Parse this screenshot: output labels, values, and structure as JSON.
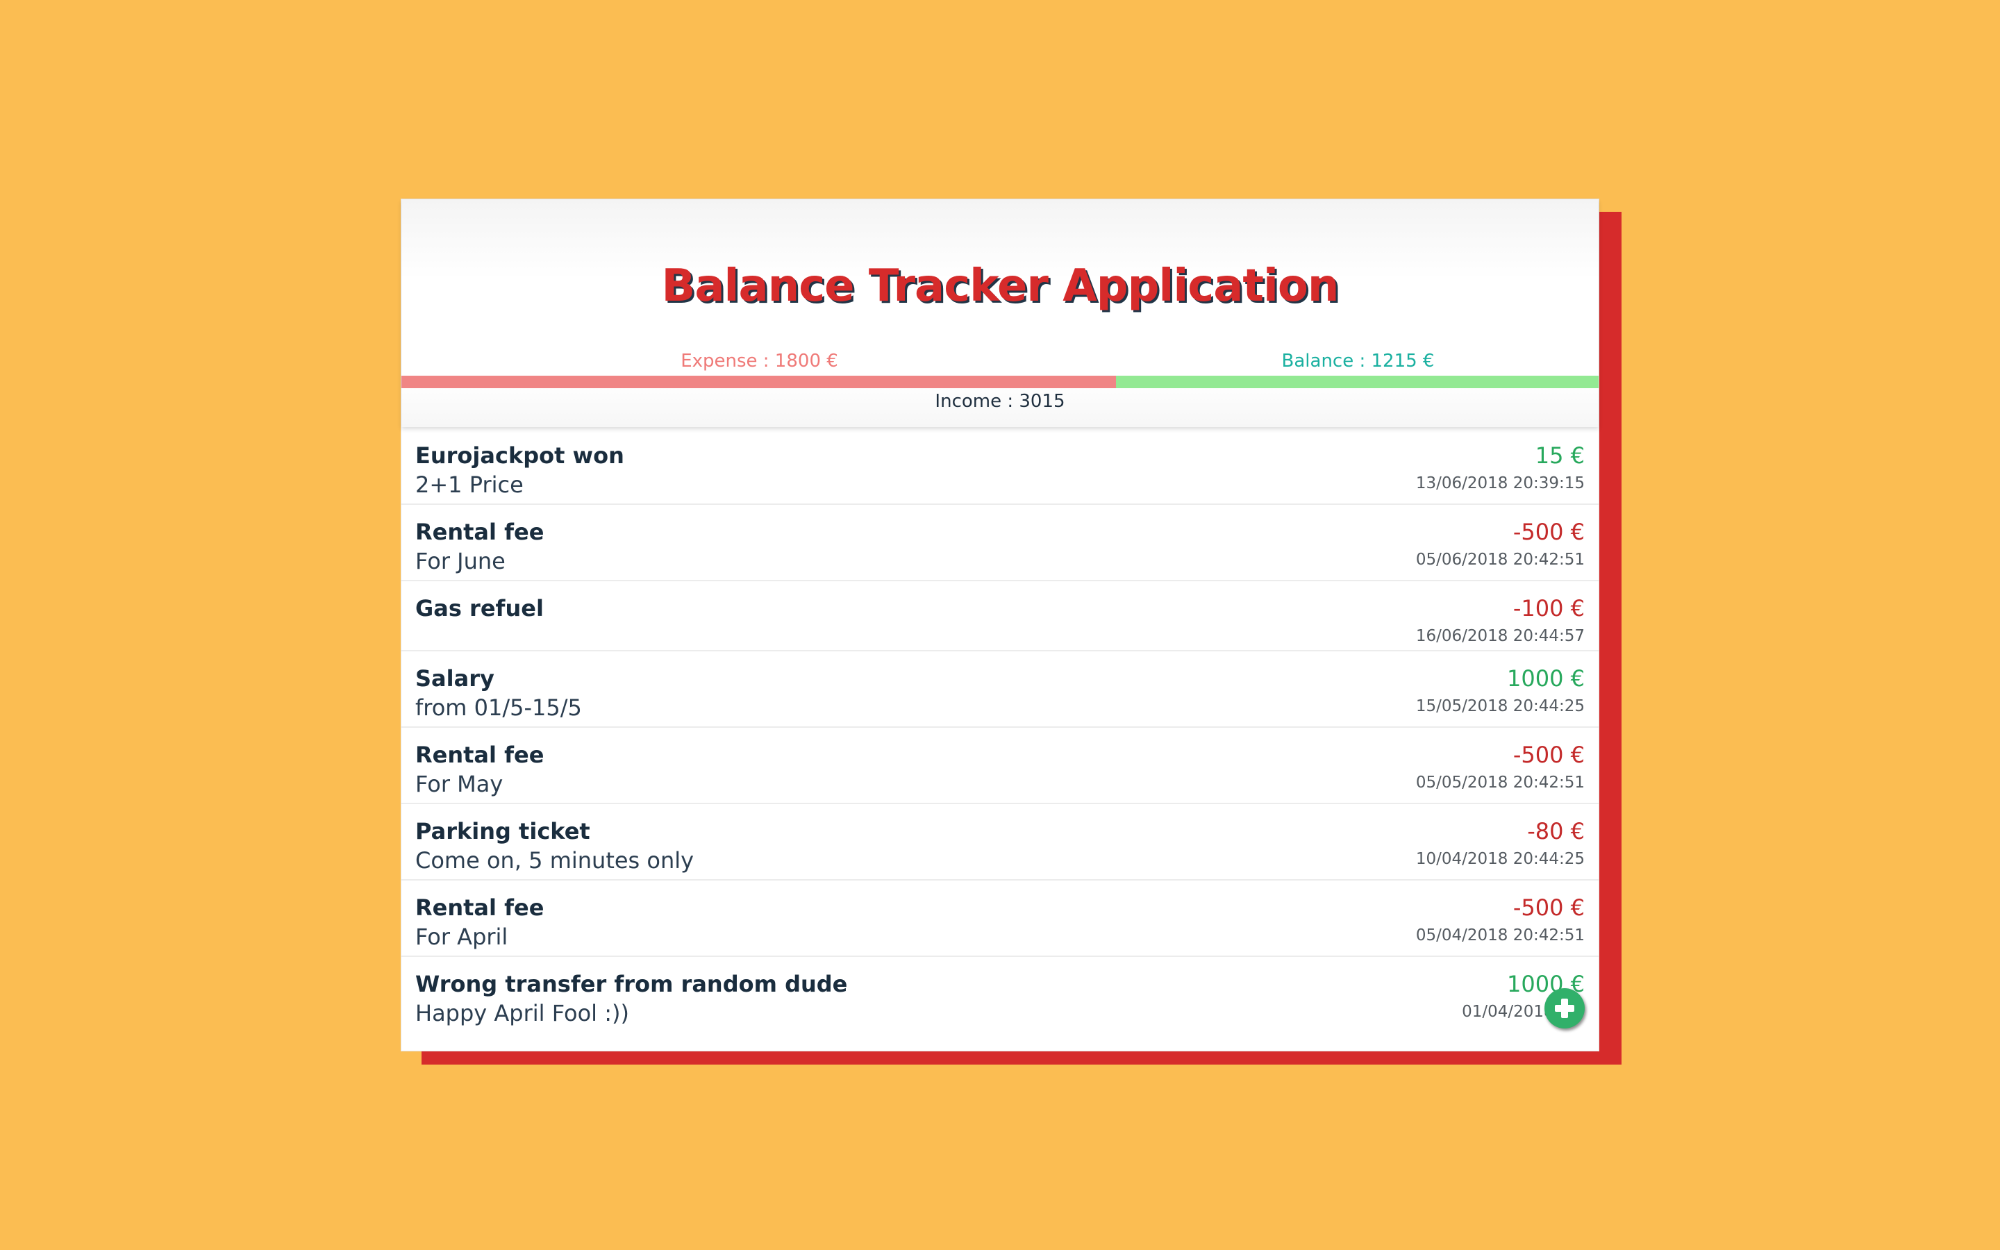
{
  "app": {
    "title": "Balance Tracker Application"
  },
  "summary": {
    "expense_label": "Expense : 1800 €",
    "balance_label": "Balance : 1215 €",
    "income_label": "Income : 3015",
    "expense_fraction": 0.597
  },
  "colors": {
    "accent": "#d62b2b",
    "background": "#fbbd52",
    "positive": "#27a85c",
    "negative": "#c42a2a",
    "expense_bar": "#f08585",
    "balance_bar": "#93e993"
  },
  "transactions": [
    {
      "title": "Eurojackpot won",
      "description": "2+1 Price",
      "amount": "15 €",
      "sign": "pos",
      "date": "13/06/2018 20:39:15"
    },
    {
      "title": "Rental fee",
      "description": "For June",
      "amount": "-500 €",
      "sign": "neg",
      "date": "05/06/2018 20:42:51"
    },
    {
      "title": "Gas refuel",
      "description": "",
      "amount": "-100 €",
      "sign": "neg",
      "date": "16/06/2018 20:44:57"
    },
    {
      "title": "Salary",
      "description": "from 01/5-15/5",
      "amount": "1000 €",
      "sign": "pos",
      "date": "15/05/2018 20:44:25"
    },
    {
      "title": "Rental fee",
      "description": "For May",
      "amount": "-500 €",
      "sign": "neg",
      "date": "05/05/2018 20:42:51"
    },
    {
      "title": "Parking ticket",
      "description": "Come on, 5 minutes only",
      "amount": "-80 €",
      "sign": "neg",
      "date": "10/04/2018 20:44:25"
    },
    {
      "title": "Rental fee",
      "description": "For April",
      "amount": "-500 €",
      "sign": "neg",
      "date": "05/04/2018 20:42:51"
    },
    {
      "title": "Wrong transfer from random dude",
      "description": "Happy April Fool :))",
      "amount": "1000 €",
      "sign": "pos",
      "date": "01/04/2018 00:"
    }
  ],
  "fab": {
    "icon": "plus-icon"
  }
}
